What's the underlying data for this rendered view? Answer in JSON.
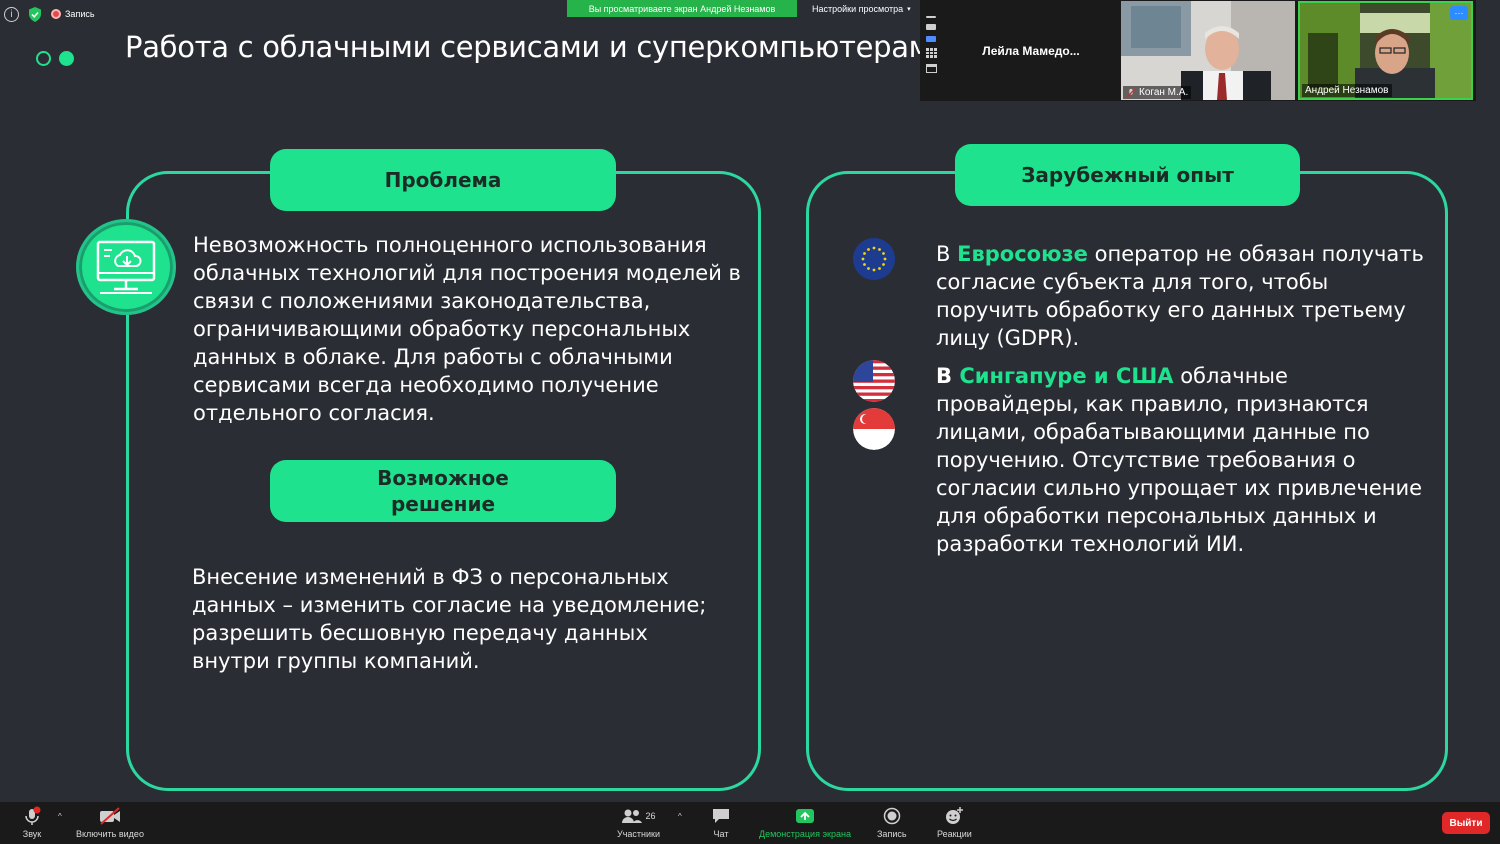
{
  "zoom": {
    "recording_label": "Запись",
    "viewing_banner": "Вы просматриваете экран Андрей Незнамов",
    "view_settings": "Настройки просмотра",
    "participants": [
      {
        "name": "Лейла  Мамедо..."
      },
      {
        "name": "Коган М.А."
      },
      {
        "name": "Андрей Незнамов"
      }
    ],
    "more_label": "···"
  },
  "slide": {
    "title": "Работа с облачными сервисами и суперкомпьютерами",
    "problem": {
      "heading": "Проблема",
      "text": "Невозможность полноценного использования облачных технологий для построения моделей в связи с положениями законодательства, ограничивающими обработку персональных данных в облаке. Для  работы с облачными сервисами всегда необходимо получение отдельного согласия."
    },
    "solution": {
      "heading_line1": "Возможное",
      "heading_line2": "решение",
      "text": "Внесение изменений в ФЗ о персональных данных  – изменить согласие на уведомление; разрешить бесшовную передачу данных внутри группы компаний."
    },
    "foreign": {
      "heading": "Зарубежный опыт",
      "eu_prefix": "В ",
      "eu_highlight": "Евросоюзе",
      "eu_text": " оператор не обязан получать согласие субъекта для того, чтобы поручить обработку его данных третьему лицу (GDPR).",
      "sg_prefix": "В ",
      "sg_highlight": "Сингапуре и США",
      "sg_text": " облачные провайдеры, как правило, признаются лицами, обрабатывающими данные по поручению. Отсутствие требования о согласии сильно упрощает их привлечение для обработки персональных данных и разработки технологий ИИ."
    },
    "accent_color": "#1ee28d"
  },
  "toolbar": {
    "audio": "Звук",
    "video": "Включить видео",
    "participants": "Участники",
    "participants_count": "26",
    "chat": "Чат",
    "share": "Демонстрация экрана",
    "record": "Запись",
    "reactions": "Реакции",
    "leave": "Выйти"
  }
}
